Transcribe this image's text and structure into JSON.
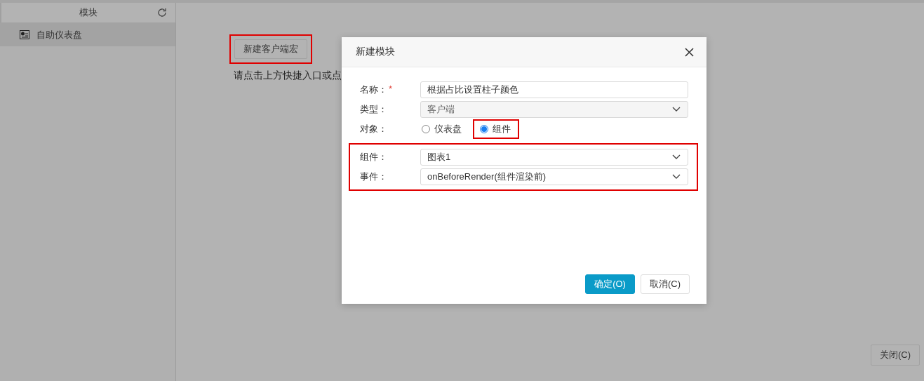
{
  "sidebar": {
    "header": "模块",
    "items": [
      {
        "label": "自助仪表盘",
        "selected": true
      }
    ]
  },
  "main": {
    "new_button": {
      "label": "新建客户端宏",
      "highlighted": true
    },
    "hint": "请点击上方快捷入口或点",
    "close_button": "关闭(C)"
  },
  "dialog": {
    "title": "新建模块",
    "field_groups": [
      {
        "highlighted": false,
        "fields": [
          {
            "kind": "text",
            "label": "名称：",
            "required_mark": "*",
            "value": "根据占比设置柱子颜色"
          },
          {
            "kind": "select",
            "label": "类型：",
            "value": "客户端",
            "disabled": true
          },
          {
            "kind": "radio",
            "label": "对象：",
            "options": [
              {
                "label": "仪表盘",
                "selected": false,
                "highlighted": false
              },
              {
                "label": "组件",
                "selected": true,
                "highlighted": true
              }
            ]
          }
        ]
      },
      {
        "highlighted": true,
        "fields": [
          {
            "kind": "select",
            "label": "组件：",
            "value": "图表1",
            "disabled": false
          },
          {
            "kind": "select",
            "label": "事件：",
            "value": "onBeforeRender(组件渲染前)",
            "disabled": false
          }
        ]
      }
    ],
    "buttons": [
      {
        "kind": "primary",
        "label": "确定(O)"
      },
      {
        "kind": "default",
        "label": "取消(C)"
      }
    ]
  }
}
